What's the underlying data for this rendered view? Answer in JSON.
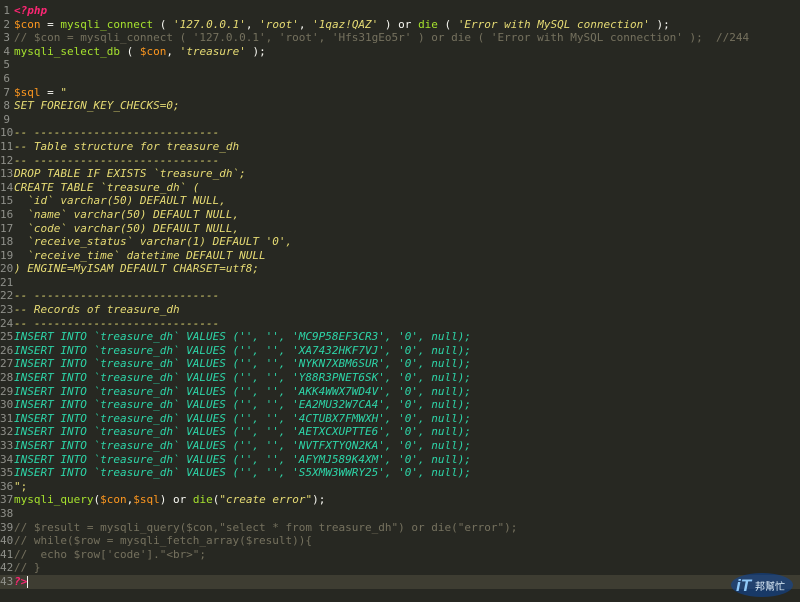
{
  "editor": {
    "lines": [
      {
        "n": "1",
        "segs": [
          {
            "c": "kw-php",
            "t": "<?php"
          }
        ]
      },
      {
        "n": "2",
        "segs": [
          {
            "c": "var",
            "t": "$con"
          },
          {
            "c": "plain",
            "t": " = "
          },
          {
            "c": "fn",
            "t": "mysqli_connect"
          },
          {
            "c": "plain",
            "t": " ( "
          },
          {
            "c": "str italic",
            "t": "'127.0.0.1'"
          },
          {
            "c": "plain",
            "t": ", "
          },
          {
            "c": "str italic",
            "t": "'root'"
          },
          {
            "c": "plain",
            "t": ", "
          },
          {
            "c": "str italic",
            "t": "'1qaz!QAZ'"
          },
          {
            "c": "plain",
            "t": " ) or "
          },
          {
            "c": "fn",
            "t": "die"
          },
          {
            "c": "plain",
            "t": " ( "
          },
          {
            "c": "str italic",
            "t": "'Error with MySQL connection'"
          },
          {
            "c": "plain",
            "t": " );"
          }
        ]
      },
      {
        "n": "3",
        "segs": [
          {
            "c": "cmt",
            "t": "// $con = mysqli_connect ( '127.0.0.1', 'root', 'Hfs31gEo5r' ) or die ( 'Error with MySQL connection' );  //244"
          }
        ]
      },
      {
        "n": "4",
        "segs": [
          {
            "c": "fn",
            "t": "mysqli_select_db"
          },
          {
            "c": "plain",
            "t": " ( "
          },
          {
            "c": "var",
            "t": "$con"
          },
          {
            "c": "plain",
            "t": ", "
          },
          {
            "c": "str italic",
            "t": "'treasure'"
          },
          {
            "c": "plain",
            "t": " );"
          }
        ]
      },
      {
        "n": "5",
        "segs": []
      },
      {
        "n": "6",
        "segs": []
      },
      {
        "n": "7",
        "segs": [
          {
            "c": "var",
            "t": "$sql"
          },
          {
            "c": "plain",
            "t": " = "
          },
          {
            "c": "str",
            "t": "\""
          }
        ]
      },
      {
        "n": "8",
        "segs": [
          {
            "c": "sql",
            "t": "SET FOREIGN_KEY_CHECKS=0;"
          }
        ]
      },
      {
        "n": "9",
        "segs": []
      },
      {
        "n": "10",
        "segs": [
          {
            "c": "sql",
            "t": "-- ----------------------------"
          }
        ]
      },
      {
        "n": "11",
        "segs": [
          {
            "c": "sql",
            "t": "-- Table structure for treasure_dh"
          }
        ]
      },
      {
        "n": "12",
        "segs": [
          {
            "c": "sql",
            "t": "-- ----------------------------"
          }
        ]
      },
      {
        "n": "13",
        "segs": [
          {
            "c": "sql",
            "t": "DROP TABLE IF EXISTS `treasure_dh`;"
          }
        ]
      },
      {
        "n": "14",
        "segs": [
          {
            "c": "sql",
            "t": "CREATE TABLE `treasure_dh` ("
          }
        ]
      },
      {
        "n": "15",
        "segs": [
          {
            "c": "sql",
            "t": "  `id` varchar(50) DEFAULT NULL,"
          }
        ]
      },
      {
        "n": "16",
        "segs": [
          {
            "c": "sql",
            "t": "  `name` varchar(50) DEFAULT NULL,"
          }
        ]
      },
      {
        "n": "17",
        "segs": [
          {
            "c": "sql",
            "t": "  `code` varchar(50) DEFAULT NULL,"
          }
        ]
      },
      {
        "n": "18",
        "segs": [
          {
            "c": "sql",
            "t": "  `receive_status` varchar(1) DEFAULT '0',"
          }
        ]
      },
      {
        "n": "19",
        "segs": [
          {
            "c": "sql",
            "t": "  `receive_time` datetime DEFAULT NULL"
          }
        ]
      },
      {
        "n": "20",
        "segs": [
          {
            "c": "sql",
            "t": ") ENGINE=MyISAM DEFAULT CHARSET=utf8;"
          }
        ]
      },
      {
        "n": "21",
        "segs": []
      },
      {
        "n": "22",
        "segs": [
          {
            "c": "sql",
            "t": "-- ----------------------------"
          }
        ]
      },
      {
        "n": "23",
        "segs": [
          {
            "c": "sql",
            "t": "-- Records of treasure_dh"
          }
        ]
      },
      {
        "n": "24",
        "segs": [
          {
            "c": "sql",
            "t": "-- ----------------------------"
          }
        ]
      },
      {
        "n": "25",
        "segs": [
          {
            "c": "sql-ins",
            "t": "INSERT INTO `treasure_dh` VALUES ('', '', 'MC9P58EF3CR3', '0', null);"
          }
        ]
      },
      {
        "n": "26",
        "segs": [
          {
            "c": "sql-ins",
            "t": "INSERT INTO `treasure_dh` VALUES ('', '', 'XA7432HKF7VJ', '0', null);"
          }
        ]
      },
      {
        "n": "27",
        "segs": [
          {
            "c": "sql-ins",
            "t": "INSERT INTO `treasure_dh` VALUES ('', '', 'NYKN7XBM6SUR', '0', null);"
          }
        ]
      },
      {
        "n": "28",
        "segs": [
          {
            "c": "sql-ins",
            "t": "INSERT INTO `treasure_dh` VALUES ('', '', 'Y88R3PNET6SK', '0', null);"
          }
        ]
      },
      {
        "n": "29",
        "segs": [
          {
            "c": "sql-ins",
            "t": "INSERT INTO `treasure_dh` VALUES ('', '', 'AKK4WWX7WD4V', '0', null);"
          }
        ]
      },
      {
        "n": "30",
        "segs": [
          {
            "c": "sql-ins",
            "t": "INSERT INTO `treasure_dh` VALUES ('', '', 'EA2MU32W7CA4', '0', null);"
          }
        ]
      },
      {
        "n": "31",
        "segs": [
          {
            "c": "sql-ins",
            "t": "INSERT INTO `treasure_dh` VALUES ('', '', '4CTUBX7FMWXH', '0', null);"
          }
        ]
      },
      {
        "n": "32",
        "segs": [
          {
            "c": "sql-ins",
            "t": "INSERT INTO `treasure_dh` VALUES ('', '', 'AETXCXUPTTE6', '0', null);"
          }
        ]
      },
      {
        "n": "33",
        "segs": [
          {
            "c": "sql-ins",
            "t": "INSERT INTO `treasure_dh` VALUES ('', '', 'NVTFXTYQN2KA', '0', null);"
          }
        ]
      },
      {
        "n": "34",
        "segs": [
          {
            "c": "sql-ins",
            "t": "INSERT INTO `treasure_dh` VALUES ('', '', 'AFYMJ589K4XM', '0', null);"
          }
        ]
      },
      {
        "n": "35",
        "segs": [
          {
            "c": "sql-ins",
            "t": "INSERT INTO `treasure_dh` VALUES ('', '', 'S5XMW3WWRY25', '0', null);"
          }
        ]
      },
      {
        "n": "36",
        "segs": [
          {
            "c": "str",
            "t": "\";"
          }
        ]
      },
      {
        "n": "37",
        "segs": [
          {
            "c": "fn",
            "t": "mysqli_query"
          },
          {
            "c": "plain",
            "t": "("
          },
          {
            "c": "var",
            "t": "$con"
          },
          {
            "c": "plain",
            "t": ","
          },
          {
            "c": "var",
            "t": "$sql"
          },
          {
            "c": "plain",
            "t": ") or "
          },
          {
            "c": "fn",
            "t": "die"
          },
          {
            "c": "plain",
            "t": "("
          },
          {
            "c": "str italic",
            "t": "\"create error\""
          },
          {
            "c": "plain",
            "t": ");"
          }
        ]
      },
      {
        "n": "38",
        "segs": []
      },
      {
        "n": "39",
        "segs": [
          {
            "c": "cmt",
            "t": "// $result = mysqli_query($con,\"select * from treasure_dh\") or die(\"error\");"
          }
        ]
      },
      {
        "n": "40",
        "segs": [
          {
            "c": "cmt",
            "t": "// while($row = mysqli_fetch_array($result)){"
          }
        ]
      },
      {
        "n": "41",
        "segs": [
          {
            "c": "cmt",
            "t": "//  echo $row['code'].\"<br>\";"
          }
        ]
      },
      {
        "n": "42",
        "segs": [
          {
            "c": "cmt",
            "t": "// }"
          }
        ]
      },
      {
        "n": "43",
        "segs": [
          {
            "c": "kw-php",
            "t": "?>"
          }
        ],
        "current": true
      }
    ]
  },
  "watermark": {
    "brand_latin": "iT",
    "brand_cjk": "邦幫忙",
    "colors": {
      "blue": "#1e88e5",
      "light": "#90caf9"
    }
  }
}
